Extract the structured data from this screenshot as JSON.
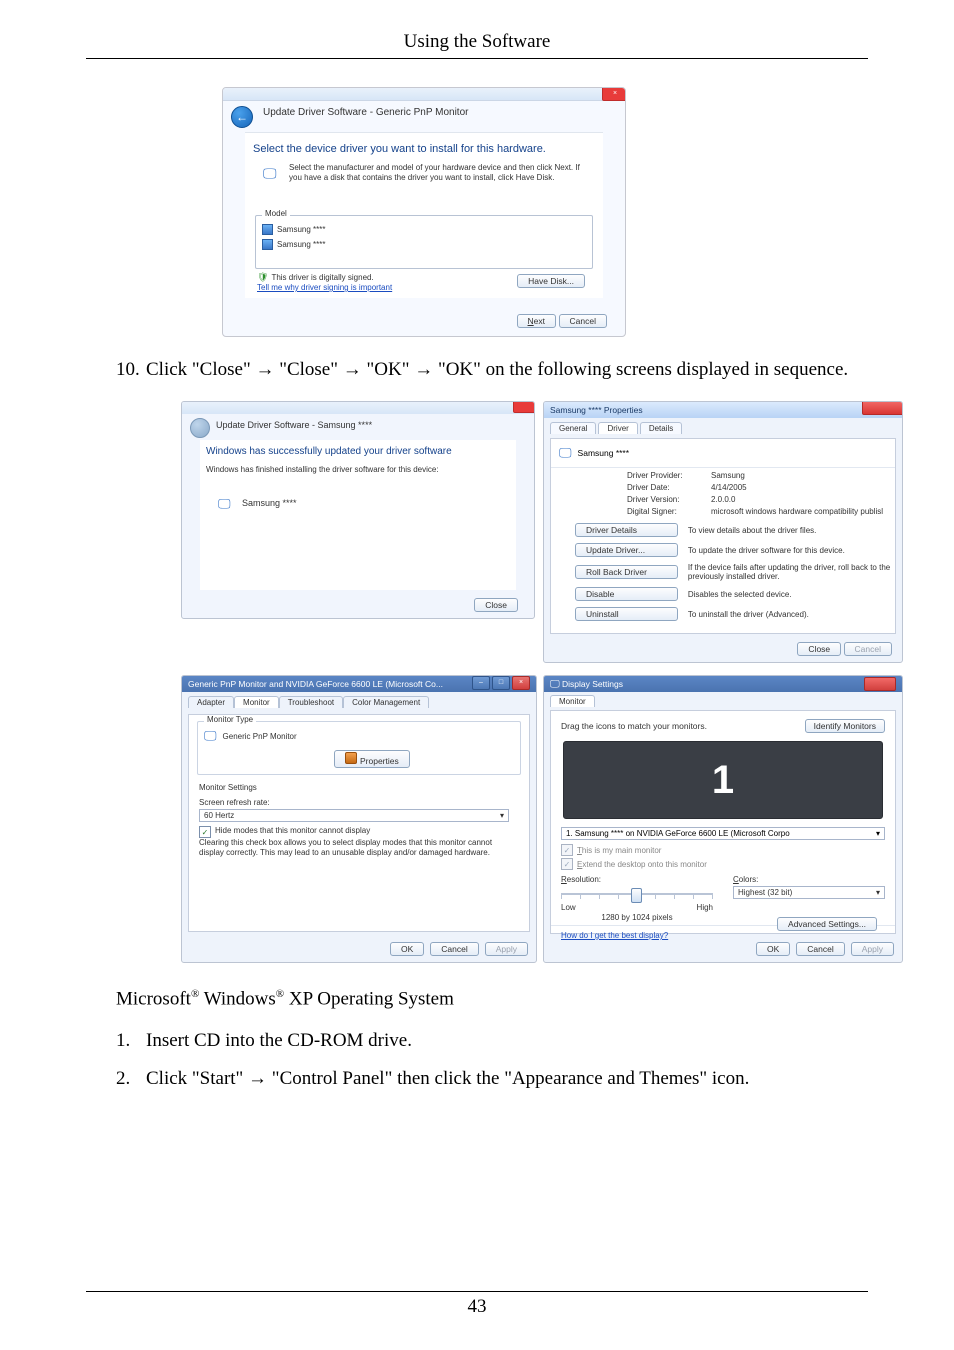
{
  "header": {
    "title": "Using the Software"
  },
  "wizard1": {
    "close_glyph": "×",
    "back_glyph": "←",
    "breadcrumb": "Update Driver Software - Generic PnP Monitor",
    "heading": "Select the device driver you want to install for this hardware.",
    "description": "Select the manufacturer and model of your hardware device and then click Next. If you have a disk that contains the driver you want to install, click Have Disk.",
    "model_label": "Model",
    "items": [
      "Samsung ****",
      "Samsung ****"
    ],
    "signed": "This driver is digitally signed.",
    "why": "Tell me why driver signing is important",
    "have_disk": "Have Disk...",
    "next": "Next",
    "cancel": "Cancel"
  },
  "step10": {
    "num": "10.",
    "text": "Click \"Close\" → \"Close\" → \"OK\" → \"OK\" on the following screens displayed in sequence."
  },
  "panelA": {
    "breadcrumb": "Update Driver Software - Samsung ****",
    "heading": "Windows has successfully updated your driver software",
    "sub": "Windows has finished installing the driver software for this device:",
    "name": "Samsung ****",
    "close": "Close"
  },
  "panelB": {
    "title": "Samsung **** Properties",
    "tabs": {
      "general": "General",
      "driver": "Driver",
      "details": "Details"
    },
    "monname": "Samsung ****",
    "kv": {
      "provider_k": "Driver Provider:",
      "provider_v": "Samsung",
      "date_k": "Driver Date:",
      "date_v": "4/14/2005",
      "version_k": "Driver Version:",
      "version_v": "2.0.0.0",
      "signer_k": "Digital Signer:",
      "signer_v": "microsoft windows hardware compatibility publisl"
    },
    "buttons": {
      "details": "Driver Details",
      "details_d": "To view details about the driver files.",
      "update": "Update Driver...",
      "update_d": "To update the driver software for this device.",
      "rollback": "Roll Back Driver",
      "rollback_d": "If the device fails after updating the driver, roll back to the previously installed driver.",
      "disable": "Disable",
      "disable_d": "Disables the selected device.",
      "uninstall": "Uninstall",
      "uninstall_d": "To uninstall the driver (Advanced)."
    },
    "close": "Close",
    "cancel": "Cancel"
  },
  "panelC": {
    "title": "Generic PnP Monitor and NVIDIA GeForce 6600 LE (Microsoft Co...",
    "tabs": {
      "adapter": "Adapter",
      "monitor": "Monitor",
      "troubleshoot": "Troubleshoot",
      "color": "Color Management"
    },
    "group1": "Monitor Type",
    "monname": "Generic PnP Monitor",
    "properties": "Properties",
    "group2": "Monitor Settings",
    "refresh_label": "Screen refresh rate:",
    "refresh_value": "60 Hertz",
    "hide_cb": "Hide modes that this monitor cannot display",
    "note": "Clearing this check box allows you to select display modes that this monitor cannot display correctly. This may lead to an unusable display and/or damaged hardware.",
    "ok": "OK",
    "cancel": "Cancel",
    "apply": "Apply"
  },
  "panelD": {
    "title": "Display Settings",
    "tab": "Monitor",
    "drag": "Drag the icons to match your monitors.",
    "identify": "Identify Monitors",
    "one": "1",
    "select": "1. Samsung **** on NVIDIA GeForce 6600 LE (Microsoft Corpo",
    "main_cb": "This is my main monitor",
    "extend_cb": "Extend the desktop onto this monitor",
    "resolution": "Resolution:",
    "low": "Low",
    "high": "High",
    "px": "1280 by 1024 pixels",
    "colors": "Colors:",
    "color_value": "Highest (32 bit)",
    "link": "How do I get the best display?",
    "adv": "Advanced Settings...",
    "ok": "OK",
    "cancel": "Cancel",
    "apply": "Apply"
  },
  "section": {
    "title_pre": "Microsoft",
    "reg": "®",
    "title_mid": " Windows",
    "title_post": " XP Operating System"
  },
  "steps": {
    "s1_n": "1.",
    "s1": "Insert CD into the CD-ROM drive.",
    "s2_n": "2.",
    "s2": "Click \"Start\" → \"Control Panel\" then click the \"Appearance and Themes\" icon."
  },
  "footer": {
    "page": "43"
  }
}
